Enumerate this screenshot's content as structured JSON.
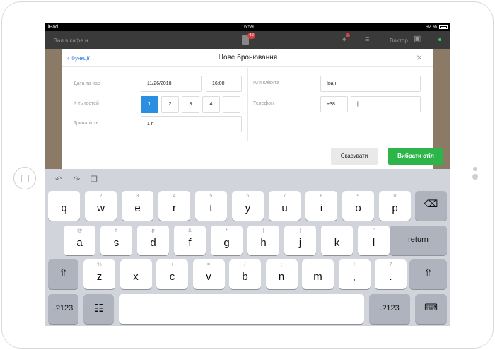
{
  "status": {
    "left": "iPad",
    "time": "16:59",
    "battery": "92 %"
  },
  "appbar": {
    "hall": "Зал в кафе н...",
    "cart_badge": "42",
    "user": "Виктор"
  },
  "modal": {
    "back": "Функції",
    "title": "Нове бронювання",
    "date_label": "Дата та час",
    "date_value": "11/26/2018",
    "time_value": "16:00",
    "guests_label": "К-ть гостей",
    "guests": [
      "1",
      "2",
      "3",
      "4",
      "..."
    ],
    "duration_label": "Тривалість",
    "duration_value": "1 г",
    "client_label": "Ім'я клієнта",
    "client_value": "Іван",
    "phone_label": "Телефон",
    "phone_code": "+38",
    "phone_value": "|",
    "cancel": "Скасувати",
    "choose": "Вибрати стіл"
  },
  "keyboard": {
    "row1": [
      [
        "1",
        "q"
      ],
      [
        "2",
        "w"
      ],
      [
        "3",
        "e"
      ],
      [
        "4",
        "r"
      ],
      [
        "5",
        "t"
      ],
      [
        "6",
        "y"
      ],
      [
        "7",
        "u"
      ],
      [
        "8",
        "i"
      ],
      [
        "9",
        "o"
      ],
      [
        "0",
        "p"
      ]
    ],
    "row2": [
      [
        "@",
        "a"
      ],
      [
        "#",
        "s"
      ],
      [
        "₽",
        "d"
      ],
      [
        "&",
        "f"
      ],
      [
        "*",
        "g"
      ],
      [
        "(",
        "h"
      ],
      [
        ")",
        "j"
      ],
      [
        "'",
        "k"
      ],
      [
        "\"",
        "l"
      ]
    ],
    "row3": [
      [
        "%",
        "z"
      ],
      [
        "-",
        "x"
      ],
      [
        "+",
        "c"
      ],
      [
        "=",
        "v"
      ],
      [
        "/",
        "b"
      ],
      [
        ";",
        "n"
      ],
      [
        ":",
        "m"
      ],
      [
        "!",
        ","
      ],
      [
        "?",
        "."
      ]
    ],
    "return": "return",
    "numbers": ".?123"
  },
  "icons": [
    "undo-icon",
    "redo-icon",
    "clipboard-icon",
    "backspace-icon",
    "shift-icon",
    "globe-icon",
    "keyboard-hide-icon",
    "lock-icon",
    "bell-icon",
    "menu-icon",
    "cart-icon"
  ]
}
